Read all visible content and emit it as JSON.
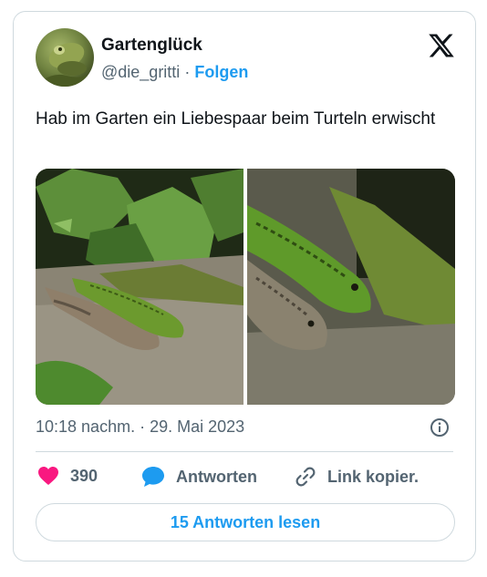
{
  "author": {
    "display_name": "Gartenglück",
    "handle": "@die_gritti",
    "separator": "·",
    "follow_label": "Folgen",
    "avatar_icon": "frog-avatar"
  },
  "brand_icon": "x-logo-icon",
  "tweet": {
    "text": "Hab im Garten ein Liebespaar beim Turteln erwischt",
    "media": [
      {
        "icon": "lizard-photo-1"
      },
      {
        "icon": "lizard-photo-2"
      }
    ],
    "timestamp": "10:18 nachm. · 29. Mai 2023"
  },
  "actions": {
    "like_count": "390",
    "reply_label": "Antworten",
    "copy_label": "Link kopier."
  },
  "read_replies_label": "15 Antworten lesen",
  "colors": {
    "accent": "#1d9bf0",
    "like": "#f91880",
    "text_secondary": "#536471",
    "border": "#cfd9de"
  }
}
